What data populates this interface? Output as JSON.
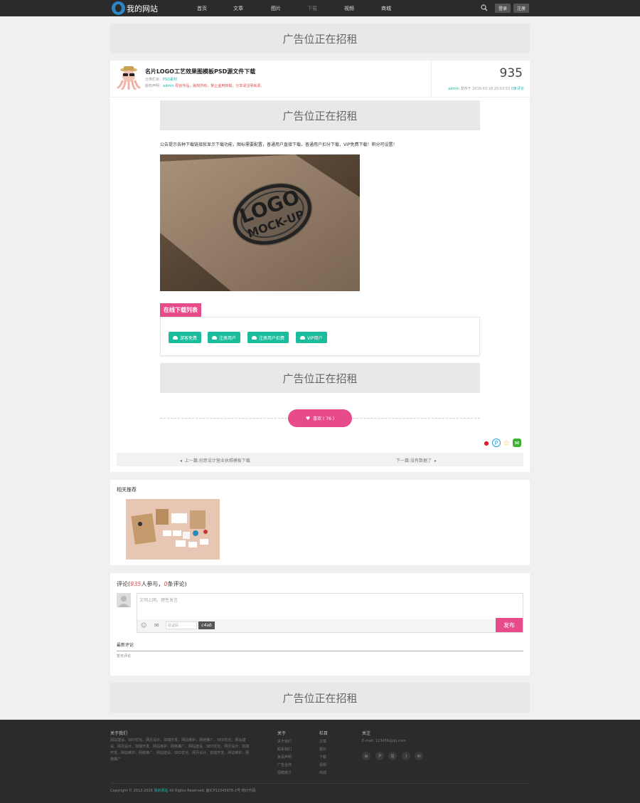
{
  "topnav": {
    "logo_text": "我的网站",
    "items": [
      "首页",
      "文章",
      "图片",
      "下载",
      "视频",
      "商城"
    ],
    "login_label": "登录",
    "register_label": "注册"
  },
  "ads": {
    "label": "广告位正在招租"
  },
  "article": {
    "title": "名片LOGO工艺效果图模板PSD源文件下载",
    "category_prefix": "分类栏目：",
    "category": "PSD素材",
    "copyright_prefix": "版权声明：",
    "author_inline": "admin",
    "copyright_text": "原创作品，版权所有，禁止盗用转载，分享请注明来源。",
    "view_count": "935",
    "meta_author": "admin",
    "meta_time": "发布于 2016-03-16 20:53:53",
    "meta_comments": "0条评论",
    "intro": "公告提示各种下载链接就显示下载功能，图标需要配置，普通用户直接下载，普通用户扣分下载，VIP免费下载！积分可设置！"
  },
  "download": {
    "tag_label": "在线下载列表",
    "buttons": [
      "游客免费",
      "注册用户",
      "注册用户扣费",
      "VIP用户"
    ]
  },
  "like": {
    "label": "喜欢 ( 76 )"
  },
  "prevnext": {
    "prev": "上一篇:创意设计营业执照模板下载",
    "next": "下一篇:没有数据了"
  },
  "related": {
    "title": "相关推荐"
  },
  "comments": {
    "title_prefix": "评论(",
    "participants": "935",
    "title_mid": "人参与，",
    "count": "0",
    "title_suffix": "条评论)",
    "placeholder": "文明上网，理性发言",
    "code_placeholder": "验证码",
    "captcha": "c4ab",
    "submit_label": "发布",
    "latest_label": "最新评论",
    "empty_label": "暂无评论"
  },
  "footer": {
    "about_title": "关于我们",
    "about_text": "网站建设、SEO优化、网页设计、前端开发、网站维护、网络推广、SEO优化、网站建设、网页设计、前端开发、网站维护、网络推广、网站建设、SEO优化、网页设计、前端开发、网站维护、网络推广、网站建设、SEO优化、网页设计、前端开发、网站维护、网络推广",
    "col_about_title": "关于",
    "col_about_links": [
      "关于我们",
      "联系我们",
      "免责声明",
      "广告合作",
      "招聘英才"
    ],
    "col_columns_title": "栏目",
    "col_columns_links": [
      "文章",
      "图片",
      "下载",
      "视频",
      "商城"
    ],
    "col_follow_title": "关注",
    "email": "E-mail: 123456@qq.com",
    "copyright_pre": "Copyright © 2012-2016",
    "site_name": "我的网站",
    "copyright_post": "All Rights Reserved. 备ICP12345678-2号 统计代码"
  }
}
